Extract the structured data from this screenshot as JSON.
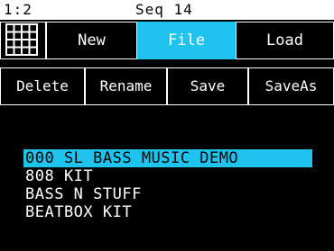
{
  "header": {
    "track": "1:2",
    "title": "Seq 14"
  },
  "buttons_top": {
    "grid_icon": "grid-icon",
    "new": "New",
    "file": "File",
    "load": "Load"
  },
  "buttons_actions": {
    "delete": "Delete",
    "rename": "Rename",
    "save": "Save",
    "saveas": "SaveAs"
  },
  "file_list": [
    "000 SL BASS MUSIC DEMO",
    "808 KIT",
    "BASS N STUFF",
    "BEATBOX KIT"
  ],
  "selected_index": 0,
  "colors": {
    "accent": "#1fc4ee",
    "background": "#000000",
    "foreground": "#ffffff"
  }
}
